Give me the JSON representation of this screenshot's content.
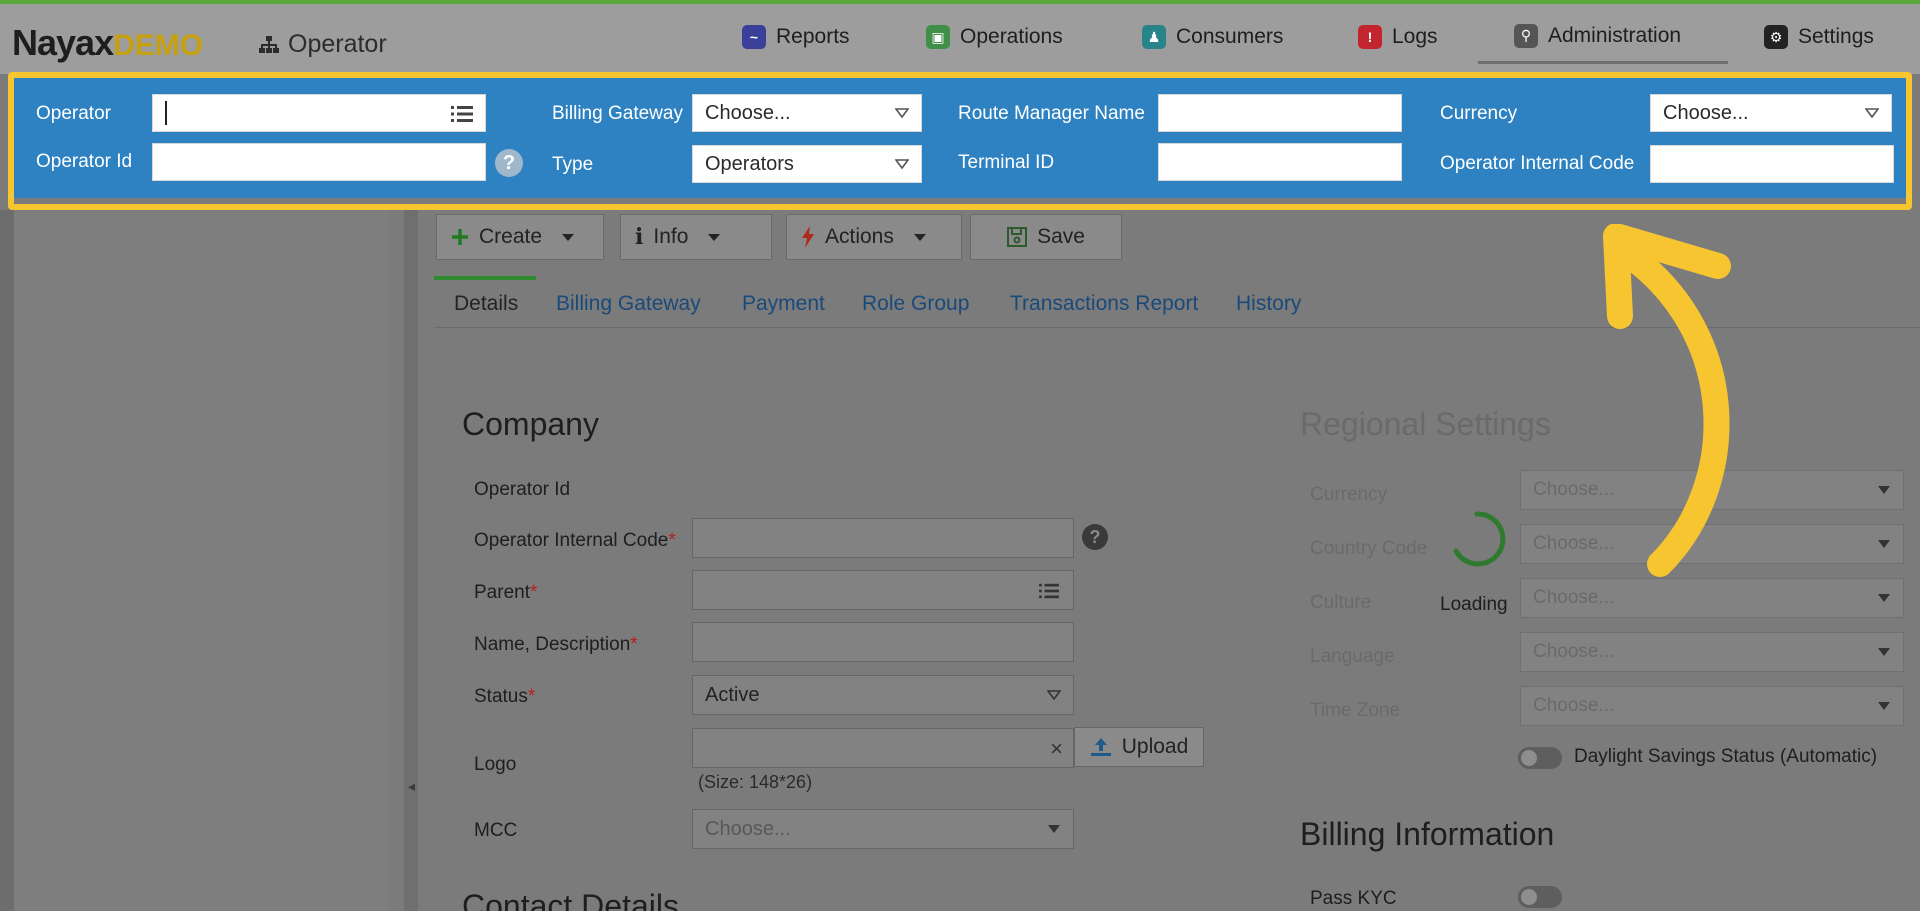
{
  "brand": {
    "name": "Nayax",
    "badge": "DEMO"
  },
  "breadcrumb": {
    "label": "Operator"
  },
  "nav": [
    {
      "label": "Reports",
      "icon": "reports-icon",
      "color": "#3a3f9a"
    },
    {
      "label": "Operations",
      "icon": "operations-icon",
      "color": "#3f8f48"
    },
    {
      "label": "Consumers",
      "icon": "consumers-icon",
      "color": "#27858a"
    },
    {
      "label": "Logs",
      "icon": "logs-icon",
      "color": "#c2252e"
    },
    {
      "label": "Administration",
      "icon": "administration-icon",
      "color": "#555555"
    },
    {
      "label": "Settings",
      "icon": "settings-icon",
      "color": "#222222"
    }
  ],
  "search": {
    "operator_label": "Operator",
    "operator_id_label": "Operator Id",
    "billing_gateway_label": "Billing Gateway",
    "billing_gateway_value": "Choose...",
    "type_label": "Type",
    "type_value": "Operators",
    "route_manager_label": "Route Manager Name",
    "terminal_id_label": "Terminal ID",
    "currency_label": "Currency",
    "currency_value": "Choose...",
    "internal_code_label": "Operator Internal Code"
  },
  "toolbar": {
    "create": "Create",
    "info": "Info",
    "actions": "Actions",
    "save": "Save"
  },
  "tabs": [
    "Details",
    "Billing Gateway",
    "Payment",
    "Role Group",
    "Transactions Report",
    "History"
  ],
  "company": {
    "title": "Company",
    "operator_id": "Operator Id",
    "internal_code": "Operator Internal Code",
    "parent": "Parent",
    "name_desc": "Name, Description",
    "status": "Status",
    "status_value": "Active",
    "logo": "Logo",
    "logo_size": "(Size: 148*26)",
    "upload": "Upload",
    "mcc": "MCC",
    "mcc_value": "Choose...",
    "req": "*"
  },
  "contact": {
    "title": "Contact Details"
  },
  "regional": {
    "title": "Regional Settings",
    "currency": "Currency",
    "country_code": "Country Code",
    "culture": "Culture",
    "language": "Language",
    "time_zone": "Time Zone",
    "placeholder": "Choose...",
    "loading": "Loading",
    "daylight": "Daylight Savings Status (Automatic)"
  },
  "billing": {
    "title": "Billing Information",
    "pass_kyc": "Pass KYC"
  }
}
